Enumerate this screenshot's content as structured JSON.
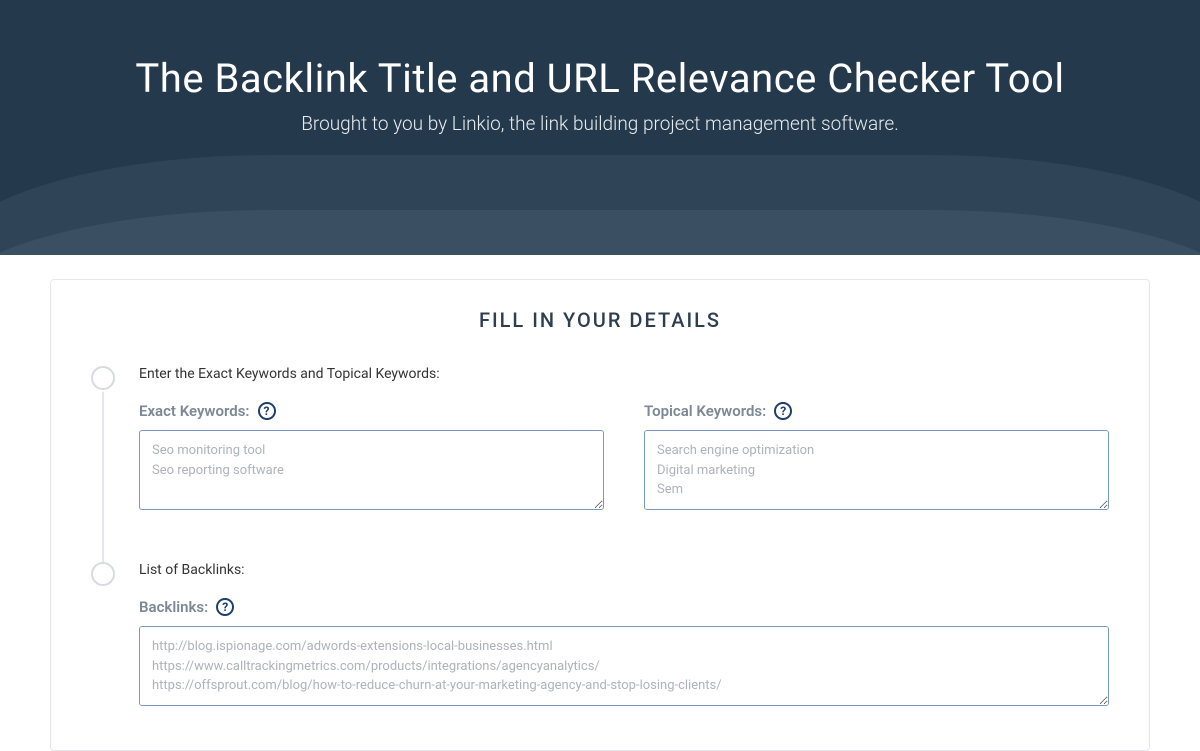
{
  "hero": {
    "title": "The Backlink Title and URL Relevance Checker Tool",
    "subtitle": "Brought to you by Linkio, the link building project management software."
  },
  "card": {
    "title": "FILL IN YOUR DETAILS"
  },
  "step1": {
    "label": "Enter the Exact Keywords and Topical Keywords:",
    "exact": {
      "label": "Exact Keywords:",
      "placeholder": "Seo monitoring tool\nSeo reporting software"
    },
    "topical": {
      "label": "Topical Keywords:",
      "placeholder": "Search engine optimization\nDigital marketing\nSem"
    }
  },
  "step2": {
    "label": "List of Backlinks:",
    "backlinks": {
      "label": "Backlinks:",
      "placeholder": "http://blog.ispionage.com/adwords-extensions-local-businesses.html\nhttps://www.calltrackingmetrics.com/products/integrations/agencyanalytics/\nhttps://offsprout.com/blog/how-to-reduce-churn-at-your-marketing-agency-and-stop-losing-clients/"
    }
  },
  "help_glyph": "?"
}
